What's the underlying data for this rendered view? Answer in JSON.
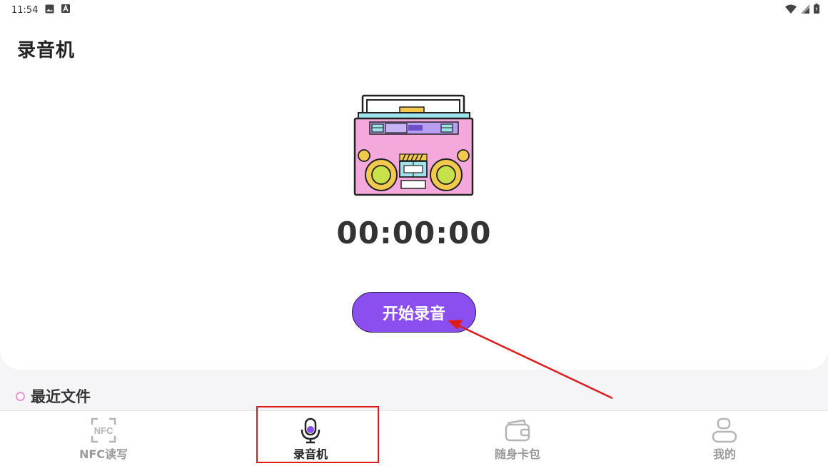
{
  "status_bar": {
    "time": "11:54",
    "icons": [
      "image-icon",
      "a-notification-icon",
      "wifi-icon",
      "cell-signal-icon",
      "battery-icon"
    ]
  },
  "header": {
    "title": "录音机"
  },
  "recorder": {
    "illustration": "boombox-icon",
    "timer": "00:00:00",
    "start_label": "开始录音",
    "accent_color": "#8b4ff0"
  },
  "recent": {
    "title": "最近文件"
  },
  "bottom_nav": {
    "items": [
      {
        "label": "NFC读写",
        "icon": "nfc-icon",
        "active": false
      },
      {
        "label": "录音机",
        "icon": "microphone-icon",
        "active": true
      },
      {
        "label": "随身卡包",
        "icon": "wallet-icon",
        "active": false
      },
      {
        "label": "我的",
        "icon": "person-icon",
        "active": false
      }
    ]
  },
  "annotation": {
    "color": "#e01b1b"
  }
}
